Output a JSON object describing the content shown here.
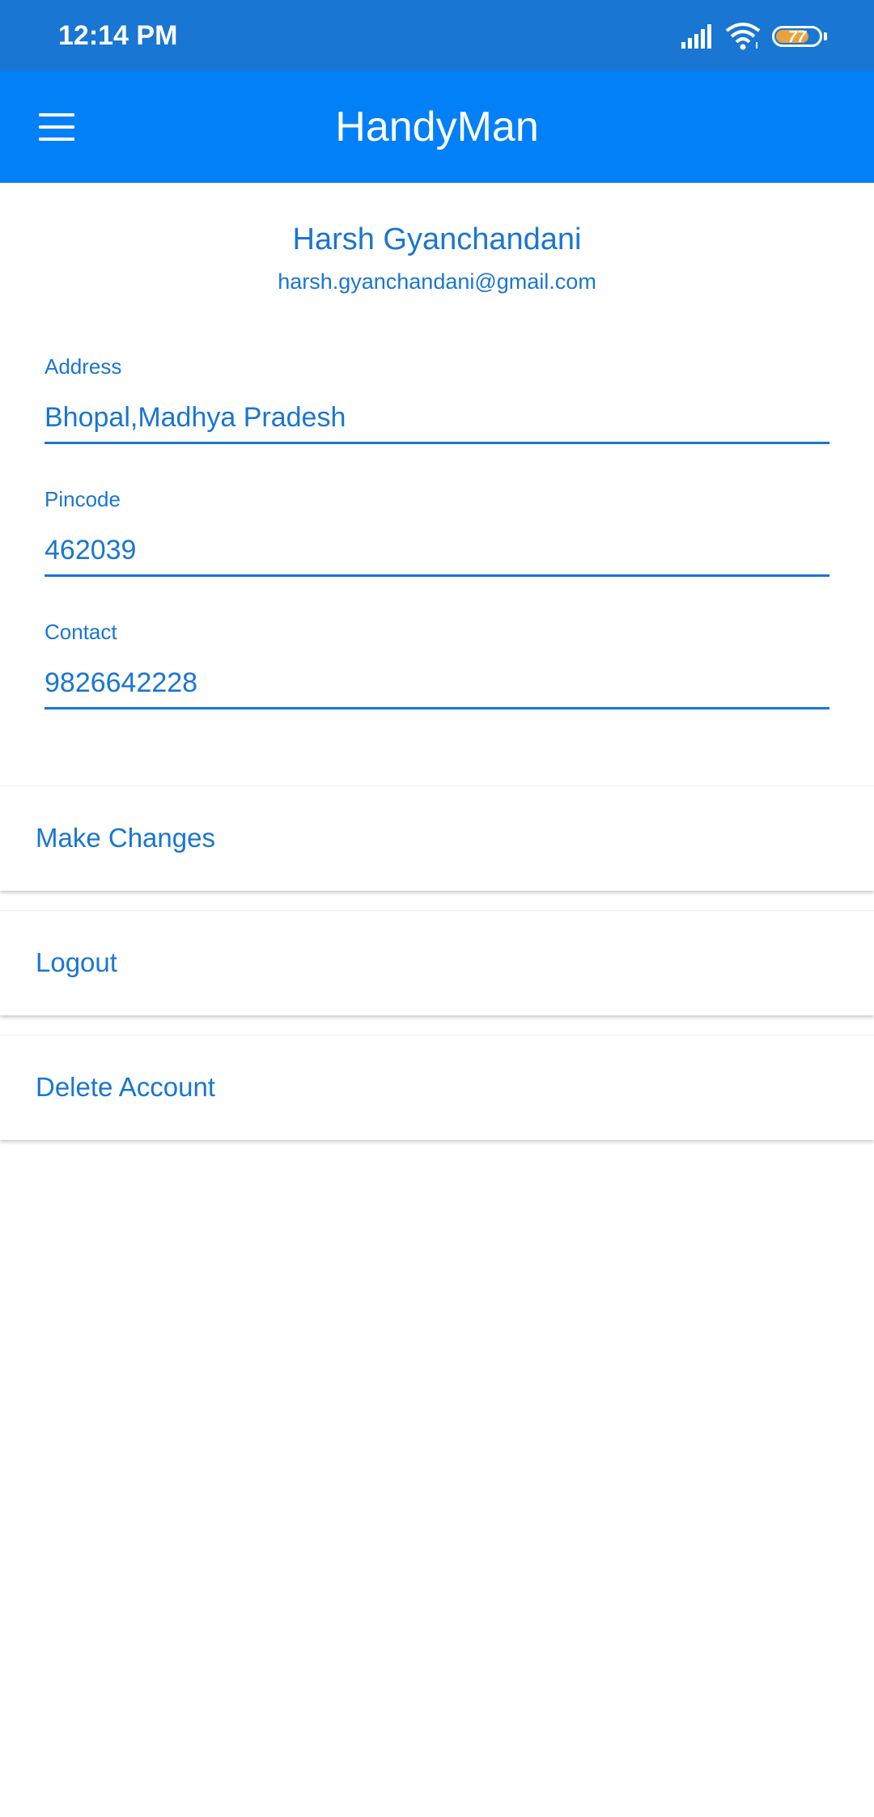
{
  "status_bar": {
    "time": "12:14 PM",
    "battery_level": "77",
    "battery_fill_color": "#e8a33c",
    "icons": [
      "signal-icon",
      "wifi-icon",
      "battery-icon"
    ]
  },
  "app_bar": {
    "title": "HandyMan",
    "menu_icon": "hamburger-menu-icon",
    "color": "#0280f8"
  },
  "profile": {
    "name": "Harsh Gyanchandani",
    "email": "harsh.gyanchandani@gmail.com"
  },
  "fields": {
    "address": {
      "label": "Address",
      "value": "Bhopal,Madhya Pradesh"
    },
    "pincode": {
      "label": "Pincode",
      "value": "462039"
    },
    "contact": {
      "label": "Contact",
      "value": "9826642228"
    }
  },
  "actions": {
    "make_changes": "Make Changes",
    "logout": "Logout",
    "delete_account": "Delete Account"
  },
  "colors": {
    "accent": "#1976d2",
    "status_bar": "#1976d2"
  }
}
